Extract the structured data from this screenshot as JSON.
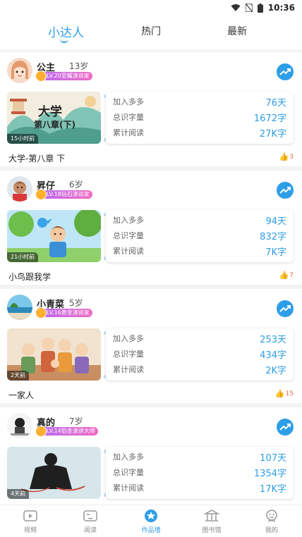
{
  "status_bar": {
    "time": "10:36"
  },
  "tabs": [
    {
      "label": "小达人",
      "active": true
    },
    {
      "label": "热门",
      "active": false
    },
    {
      "label": "最新",
      "active": false
    }
  ],
  "stat_labels": {
    "joined": "加入多多",
    "words": "总识字量",
    "reading": "累计阅读"
  },
  "posts": [
    {
      "name": "公主",
      "age": "13岁",
      "badge": "LV.20至耀演说家",
      "time_ago": "15小时前",
      "cover_line1": "大学",
      "cover_line2": "第八章(下)",
      "joined": "76天",
      "words": "1672字",
      "reading": "27K字",
      "title": "大学-第八章 下",
      "likes": "3"
    },
    {
      "name": "昇仔",
      "age": "6岁",
      "badge": "LV.18钻石演说家",
      "time_ago": "21小时前",
      "joined": "94天",
      "words": "832字",
      "reading": "7K字",
      "title": "小鸟跟我学",
      "likes": "7"
    },
    {
      "name": "小青菜",
      "age": "5岁",
      "badge": "LV.16黄金演说家",
      "time_ago": "2天前",
      "joined": "253天",
      "words": "434字",
      "reading": "2K字",
      "title": "一家人",
      "likes": "15"
    },
    {
      "name": "真的",
      "age": "7岁",
      "badge": "LV.14铂金演讲大师",
      "time_ago": "4天前",
      "joined": "107天",
      "words": "1354字",
      "reading": "17K字",
      "title": "",
      "likes": ""
    }
  ],
  "bottom_nav": [
    {
      "label": "视频",
      "icon": "video-icon",
      "active": false
    },
    {
      "label": "阅读",
      "icon": "book-icon",
      "active": false
    },
    {
      "label": "作品墙",
      "icon": "star-badge-icon",
      "active": true
    },
    {
      "label": "图书馆",
      "icon": "library-icon",
      "active": false
    },
    {
      "label": "我的",
      "icon": "profile-icon",
      "active": false
    }
  ],
  "colors": {
    "accent": "#2d9ee8",
    "like": "#f26b3a",
    "badge_start": "#b66bf2",
    "badge_end": "#f06bc4"
  }
}
